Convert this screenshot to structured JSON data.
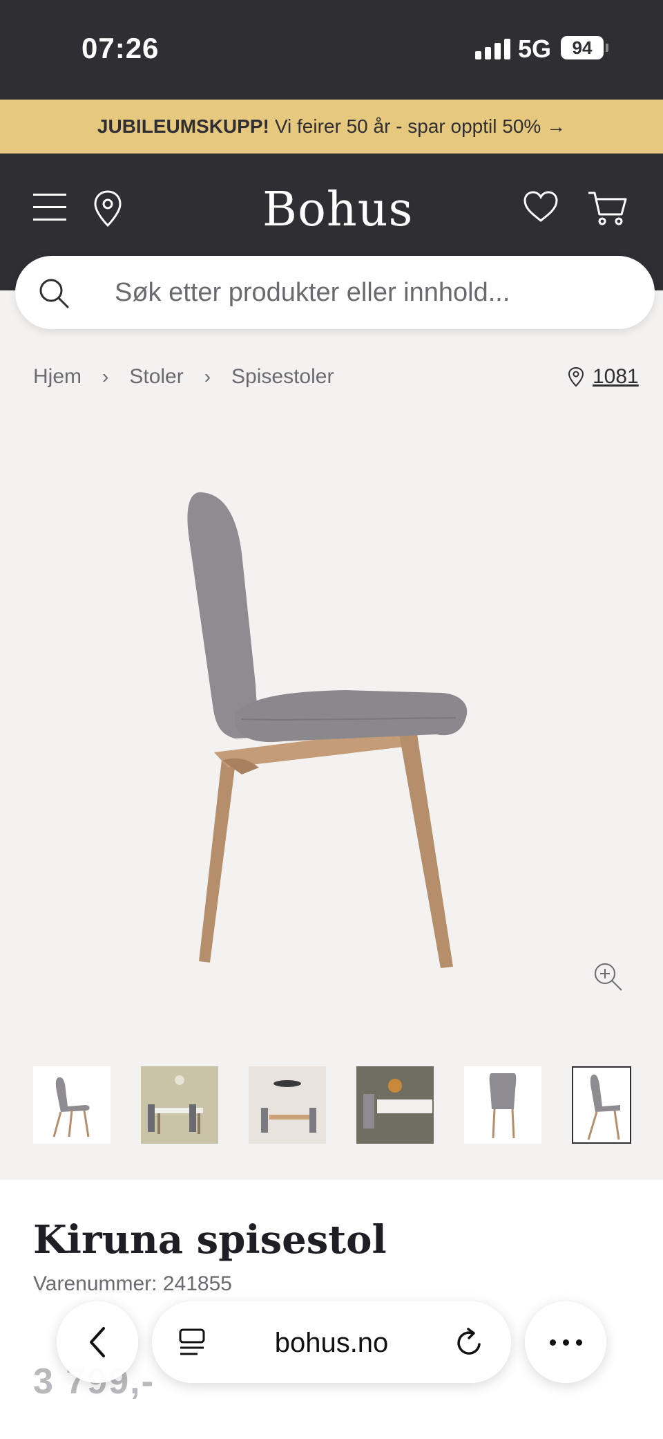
{
  "status_bar": {
    "time": "07:26",
    "network": "5G",
    "battery": "94"
  },
  "promo": {
    "bold": "JUBILEUMSKUPP!",
    "text": "Vi feirer 50 år - spar opptil 50% →"
  },
  "header": {
    "logo": "Bohus"
  },
  "search": {
    "placeholder": "Søk etter produkter eller innhold..."
  },
  "breadcrumb": {
    "items": [
      "Hjem",
      "Stoler",
      "Spisestoler"
    ],
    "separator": "›"
  },
  "store": {
    "label": "1081"
  },
  "gallery": {
    "thumbnail_count": 6,
    "active_index": 5
  },
  "product": {
    "title": "Kiruna spisestol",
    "sku": "Varenummer: 241855",
    "price": "3 799,-"
  },
  "browser": {
    "url": "bohus.no"
  },
  "colors": {
    "header_bg": "#2e2e33",
    "promo_bg": "#e6c97e",
    "page_bg": "#f4f2f1",
    "chair_fabric": "#8e8c90",
    "chair_wood": "#b58e6c"
  }
}
